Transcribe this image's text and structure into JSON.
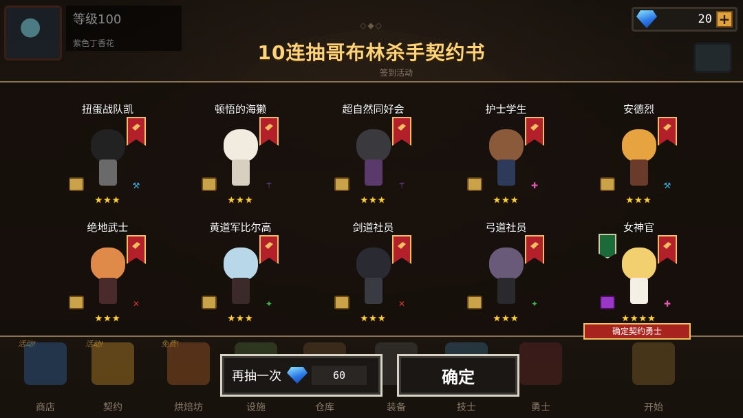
{
  "profile": {
    "level": "等级100",
    "subtitle": "紫色丁香花"
  },
  "gems": {
    "count": "20",
    "plus": "+"
  },
  "title": "10连抽哥布林杀手契约书",
  "background_label": "签到活动",
  "results": [
    {
      "name": "扭蛋战队凯",
      "stars": "★★★",
      "star_count": 3,
      "class_icon": "axe-icon",
      "class_color": "#36b6e0",
      "scroll": "gold",
      "head": "#222222",
      "body": "#6a6a6a"
    },
    {
      "name": "顿悟的海獭",
      "stars": "★★★",
      "star_count": 3,
      "class_icon": "staff-icon",
      "class_color": "#9a5ae0",
      "scroll": "gold",
      "head": "#f2ece0",
      "body": "#d8cfc0"
    },
    {
      "name": "超自然同好会",
      "stars": "★★★",
      "star_count": 3,
      "class_icon": "staff-icon",
      "class_color": "#9a5ae0",
      "scroll": "gold",
      "head": "#3a3a3e",
      "body": "#5a3a6a"
    },
    {
      "name": "护士学生",
      "stars": "★★★",
      "star_count": 3,
      "class_icon": "cross-icon",
      "class_color": "#e05ab0",
      "scroll": "gold",
      "head": "#8a5a3a",
      "body": "#2e3a5a"
    },
    {
      "name": "安德烈",
      "stars": "★★★",
      "star_count": 3,
      "class_icon": "axe-icon",
      "class_color": "#36b6e0",
      "scroll": "gold",
      "head": "#e6a340",
      "body": "#6a3a2a"
    },
    {
      "name": "绝地武士",
      "stars": "★★★",
      "star_count": 3,
      "class_icon": "sword-icon",
      "class_color": "#e03636",
      "scroll": "gold",
      "head": "#e08a4a",
      "body": "#4a2a2a"
    },
    {
      "name": "黄道军比尔高",
      "stars": "★★★",
      "star_count": 3,
      "class_icon": "bow-icon",
      "class_color": "#3ab64a",
      "scroll": "gold",
      "head": "#b8d8ea",
      "body": "#3a2a2a"
    },
    {
      "name": "剑道社员",
      "stars": "★★★",
      "star_count": 3,
      "class_icon": "sword-icon",
      "class_color": "#e03636",
      "scroll": "gold",
      "head": "#2a2a32",
      "body": "#3a3a42"
    },
    {
      "name": "弓道社员",
      "stars": "★★★",
      "star_count": 3,
      "class_icon": "bow-icon",
      "class_color": "#3ab64a",
      "scroll": "gold",
      "head": "#6a5a7a",
      "body": "#2a2a2e"
    },
    {
      "name": "女神官",
      "stars": "★★★★",
      "star_count": 4,
      "class_icon": "cross-icon",
      "class_color": "#e05ab0",
      "scroll": "purple",
      "head": "#f2d070",
      "body": "#f4f0e6"
    }
  ],
  "confirm_tag": "确定契约勇士",
  "nav": [
    {
      "label": "商店",
      "flag": "活动!",
      "icon": "shop-icon"
    },
    {
      "label": "契约",
      "flag": "活动!",
      "icon": "contract-icon"
    },
    {
      "label": "烘焙坊",
      "flag": "免费!",
      "icon": "bakery-icon"
    },
    {
      "label": "设施",
      "flag": "",
      "icon": "facility-icon"
    },
    {
      "label": "仓库",
      "flag": "",
      "icon": "warehouse-icon"
    },
    {
      "label": "装备",
      "flag": "",
      "icon": "equipment-icon"
    },
    {
      "label": "技士",
      "flag": "",
      "icon": "technician-icon"
    },
    {
      "label": "勇士",
      "flag": "",
      "icon": "warrior-icon"
    },
    {
      "label": "开始",
      "flag": "",
      "icon": "start-icon"
    }
  ],
  "buttons": {
    "draw_again": "再抽一次",
    "draw_again_cost": "60",
    "confirm": "确定"
  },
  "colors": {
    "title": "#ffd37a",
    "star": "#ffd23a",
    "accent_red": "#b3202a"
  }
}
